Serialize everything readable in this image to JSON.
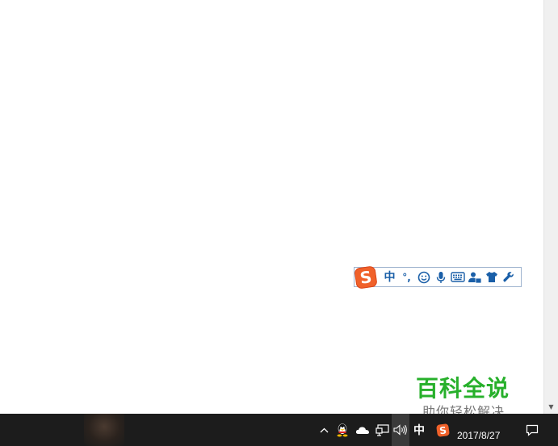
{
  "ime_toolbar": {
    "logo": "S",
    "lang_mode": "中",
    "punct_mode": "°,",
    "icons": [
      "smiley-icon",
      "microphone-icon",
      "keyboard-icon",
      "user-icon",
      "tshirt-icon",
      "wrench-icon"
    ],
    "accent": "#1a5fa8",
    "logo_color": "#f0612a"
  },
  "watermark": {
    "title": "百科全说",
    "subtitle": "助你轻松解决"
  },
  "taskbar": {
    "tray": {
      "show_hidden": "^",
      "ime_lang": "中",
      "ime_logo": "S"
    },
    "date": "2017/8/27"
  }
}
